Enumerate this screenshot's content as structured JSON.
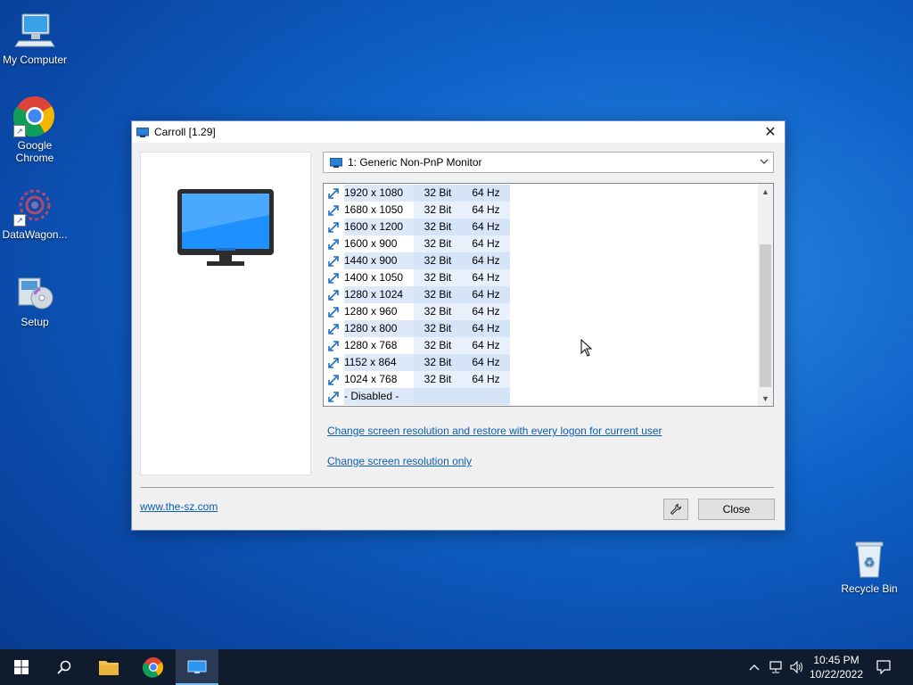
{
  "desktop": {
    "icons": [
      {
        "label": "My Computer"
      },
      {
        "label": "Google Chrome"
      },
      {
        "label": "DataWagon..."
      },
      {
        "label": "Setup"
      },
      {
        "label": "Recycle Bin"
      }
    ]
  },
  "window": {
    "title": "Carroll [1.29]",
    "monitor_select": "1: Generic Non-PnP Monitor",
    "resolutions": [
      {
        "res": "1920 x 1080",
        "bit": "32 Bit",
        "hz": "64 Hz"
      },
      {
        "res": "1680 x 1050",
        "bit": "32 Bit",
        "hz": "64 Hz"
      },
      {
        "res": "1600 x 1200",
        "bit": "32 Bit",
        "hz": "64 Hz"
      },
      {
        "res": "1600 x 900",
        "bit": "32 Bit",
        "hz": "64 Hz"
      },
      {
        "res": "1440 x 900",
        "bit": "32 Bit",
        "hz": "64 Hz"
      },
      {
        "res": "1400 x 1050",
        "bit": "32 Bit",
        "hz": "64 Hz"
      },
      {
        "res": "1280 x 1024",
        "bit": "32 Bit",
        "hz": "64 Hz"
      },
      {
        "res": "1280 x 960",
        "bit": "32 Bit",
        "hz": "64 Hz"
      },
      {
        "res": "1280 x 800",
        "bit": "32 Bit",
        "hz": "64 Hz"
      },
      {
        "res": "1280 x 768",
        "bit": "32 Bit",
        "hz": "64 Hz"
      },
      {
        "res": "1152 x 864",
        "bit": "32 Bit",
        "hz": "64 Hz"
      },
      {
        "res": "1024 x 768",
        "bit": "32 Bit",
        "hz": "64 Hz"
      },
      {
        "res": "- Disabled -",
        "bit": "",
        "hz": ""
      }
    ],
    "link_restore": "Change screen resolution and restore with every logon for current user",
    "link_only": "Change screen resolution only",
    "website": "www.the-sz.com",
    "close_button": "Close"
  },
  "taskbar": {
    "time": "10:45 PM",
    "date": "10/22/2022"
  },
  "colors": {
    "accent": "#0b5fb5",
    "desktop": "#0f63c8",
    "taskbar": "#101b2e"
  }
}
